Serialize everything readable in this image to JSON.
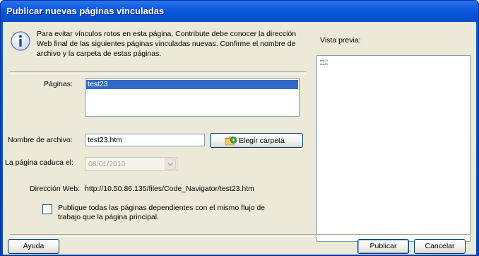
{
  "dialog": {
    "title": "Publicar nuevas páginas vinculadas",
    "info_icon": "info-icon",
    "info_text": "Para evitar vínculos rotos en esta página, Contribute debe conocer la dirección Web final de las siguientes páginas vinculadas nuevas. Confirme el nombre de archivo y la carpeta de estas páginas."
  },
  "pages": {
    "label": "Páginas:",
    "items": [
      "test23"
    ],
    "selected_index": 0
  },
  "filename": {
    "label": "Nombre de archivo:",
    "value": "test23.htm",
    "choose_folder_label": "Elegir carpeta",
    "choose_folder_icon": "folder-icon"
  },
  "expiry": {
    "label": "La página caduca el:",
    "value": "08/01/2010",
    "disabled": true
  },
  "web_address": {
    "label": "Dirección Web:",
    "value": "http://10.50.86.135/files/Code_Navigator/test23.htm"
  },
  "workflow": {
    "checked": false,
    "label": "Publique todas las páginas dependientes con el mismo flujo de trabajo que la página principal."
  },
  "preview": {
    "label": "Vista previa:",
    "lines": [
      "test23",
      "test23"
    ]
  },
  "buttons": {
    "help": "Ayuda",
    "publish": "Publicar",
    "cancel": "Cancelar"
  },
  "colors": {
    "titlebar": "#0a5bd8",
    "dialog_bg": "#ece9d8",
    "selection": "#316ac5"
  }
}
